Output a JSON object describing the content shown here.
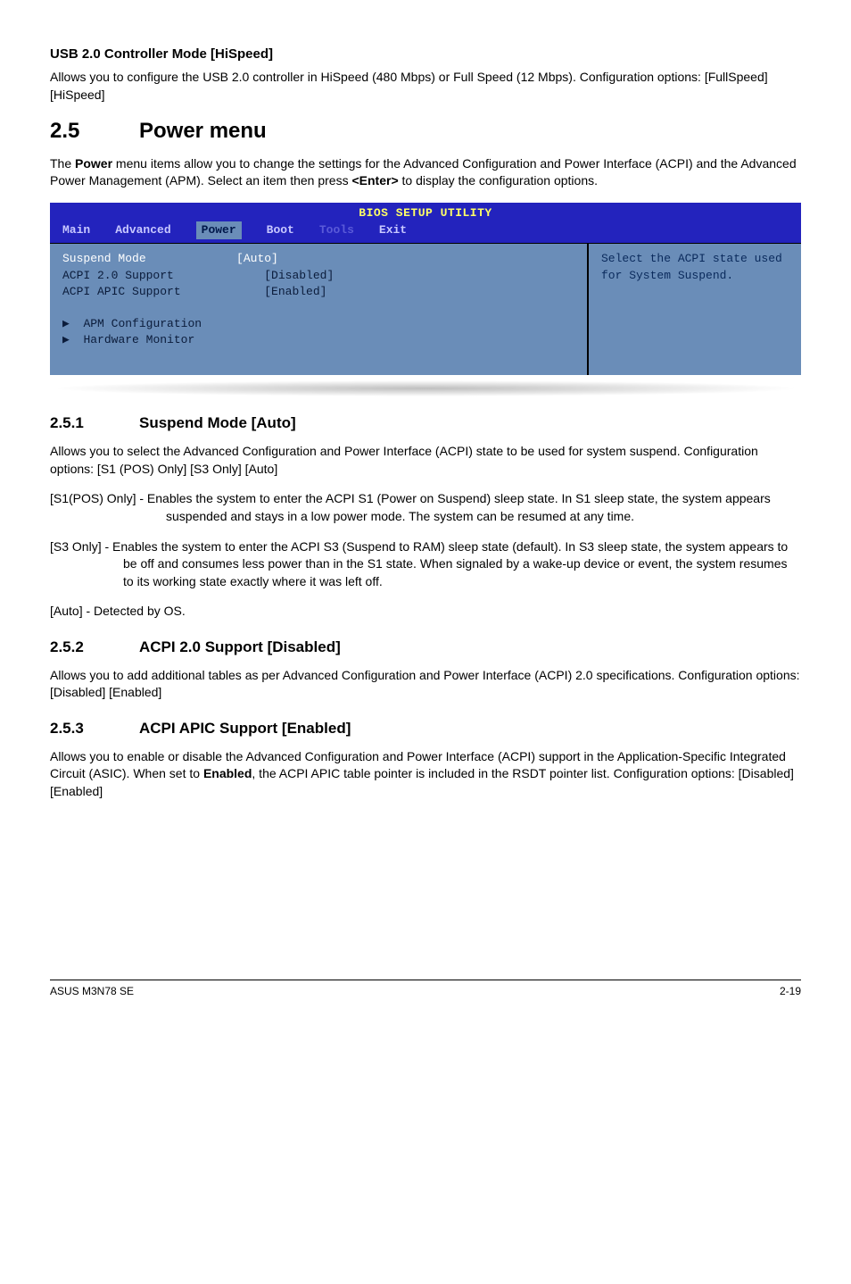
{
  "usb": {
    "heading": "USB 2.0 Controller Mode [HiSpeed]",
    "desc": "Allows you to configure the USB 2.0 controller in HiSpeed (480 Mbps) or Full Speed (12 Mbps). Configuration options: [FullSpeed] [HiSpeed]"
  },
  "section": {
    "num": "2.5",
    "title": "Power menu",
    "intro_pre": "The ",
    "intro_bold": "Power",
    "intro_mid": " menu items allow you to change the settings for the Advanced Configuration and Power Interface (ACPI) and the Advanced Power Management (APM). Select an item then press ",
    "intro_bold2": "<Enter>",
    "intro_post": " to display the configuration options."
  },
  "bios": {
    "title": "BIOS SETUP UTILITY",
    "tabs": [
      "Main",
      "Advanced",
      "Power",
      "Boot",
      "Tools",
      "Exit"
    ],
    "rows": [
      {
        "label": "Suspend Mode",
        "value": "[Auto]",
        "hl": true
      },
      {
        "label": "ACPI 2.0 Support",
        "value": "[Disabled]"
      },
      {
        "label": "ACPI APIC Support",
        "value": "[Enabled]"
      }
    ],
    "sub": [
      "APM Configuration",
      "Hardware Monitor"
    ],
    "help": "Select the ACPI state used for System Suspend."
  },
  "s251": {
    "num": "2.5.1",
    "title": "Suspend Mode [Auto]",
    "p1": "Allows you to select the Advanced Configuration and Power Interface (ACPI) state to be used for system suspend. Configuration options: [S1 (POS) Only] [S3 Only] [Auto]",
    "s1_lead": "[S1(POS) Only] - ",
    "s1_body": "Enables the system to enter the ACPI S1 (Power on Suspend) sleep state. In S1 sleep state, the system appears suspended and stays in a low power mode. The system can be resumed at any time.",
    "s3_lead": "[S3 Only] - ",
    "s3_body": "Enables the system to enter the ACPI S3 (Suspend to RAM) sleep state (default). In S3 sleep state, the system appears to be off and consumes less power than in the S1 state. When signaled by a wake-up device or event, the system resumes to its working state exactly where it was left off.",
    "auto": "[Auto] - Detected by OS."
  },
  "s252": {
    "num": "2.5.2",
    "title": "ACPI  2.0 Support [Disabled]",
    "p": "Allows you to add additional tables as per Advanced Configuration and Power Interface (ACPI) 2.0 specifications. Configuration options: [Disabled] [Enabled]"
  },
  "s253": {
    "num": "2.5.3",
    "title": "ACPI APIC Support [Enabled]",
    "p_pre": "Allows you to enable or disable the Advanced Configuration and Power Interface (ACPI) support in the Application-Specific Integrated Circuit (ASIC). When set to ",
    "p_bold": "Enabled",
    "p_post": ", the ACPI APIC table pointer is included in the RSDT pointer list. Configuration options: [Disabled] [Enabled]"
  },
  "footer": {
    "left": "ASUS M3N78 SE",
    "right": "2-19"
  }
}
